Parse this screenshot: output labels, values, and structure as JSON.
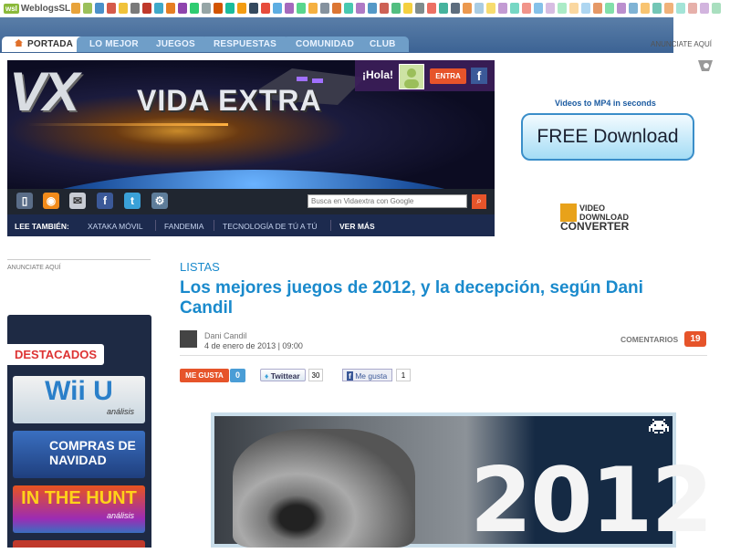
{
  "network": {
    "logo_badge": "wsl",
    "logo_text": "WeblogsSL",
    "site_icon_colors": [
      "#e8a33a",
      "#9bc05a",
      "#4a90c9",
      "#d55a4a",
      "#f0c23a",
      "#7a7a7a",
      "#c0392b",
      "#3fa9c9",
      "#e67e22",
      "#8e44ad",
      "#2ecc71",
      "#95a5a6",
      "#d35400",
      "#1abc9c",
      "#f39c12",
      "#34495e",
      "#e74c3c",
      "#5dade2",
      "#a569bd",
      "#58d68d",
      "#f5b041",
      "#85929e",
      "#dc7633",
      "#48c9b0",
      "#af7ac5",
      "#5499c7",
      "#cd6155",
      "#52be80",
      "#f4d03f",
      "#7f8c8d",
      "#ec7063",
      "#45b39d",
      "#5d6d7e",
      "#eb984e",
      "#a9cce3",
      "#f7dc6f",
      "#c39bd3",
      "#76d7c4",
      "#f1948a",
      "#85c1e9",
      "#d7bde2",
      "#abebc6",
      "#fad7a0",
      "#aed6f1",
      "#e59866",
      "#82e0aa",
      "#bb8fce",
      "#7fb3d5",
      "#f8c471",
      "#73c6b6",
      "#f0b27a",
      "#a3e4d7",
      "#e6b0aa",
      "#d2b4de",
      "#a9dfbf"
    ]
  },
  "nav": {
    "tabs": [
      {
        "label": "PORTADA",
        "active": true
      },
      {
        "label": "LO MEJOR",
        "active": false
      },
      {
        "label": "JUEGOS",
        "active": false
      },
      {
        "label": "RESPUESTAS",
        "active": false
      },
      {
        "label": "COMUNIDAD",
        "active": false
      },
      {
        "label": "CLUB",
        "active": false
      }
    ],
    "anunciate": "ANUNCIATE AQUÍ"
  },
  "banner": {
    "logo_vx": "VX",
    "logo_name": "VIDA EXTRA",
    "hola": "¡Hola!",
    "entra": "ENTRA",
    "facebook": "f",
    "search_placeholder": "Busca en Vidaextra con Google",
    "search_icon": "search-icon",
    "social_icons": [
      "mobile-icon",
      "rss-icon",
      "mail-icon",
      "facebook-icon",
      "twitter-icon",
      "settings-icon"
    ]
  },
  "lee": {
    "label": "LEE TAMBIÉN:",
    "links": [
      "XATAKA MÓVIL",
      "FANDEMIA",
      "TECNOLOGÍA DE TÚ A TÚ"
    ],
    "more": "VER MÁS"
  },
  "ad": {
    "link": "Videos to MP4 in seconds",
    "button": "FREE Download",
    "logo_line1": "VIDEO DOWNLOAD",
    "logo_line2": "CONVERTER"
  },
  "sidebar": {
    "anunciate": "ANUNCIATE AQUÍ",
    "destacados": "DESTACADOS",
    "items": [
      {
        "title": "Wii U",
        "sub": "análisis",
        "bg": "#3a8fd0"
      },
      {
        "title": "COMPRAS DE NAVIDAD",
        "sub": "",
        "bg": "#e8ecf0"
      },
      {
        "title": "IN THE HUNT",
        "sub": "análisis",
        "bg": "#f0a020"
      }
    ]
  },
  "article": {
    "section": "LISTAS",
    "title": "Los mejores juegos de 2012, y la decepción, según Dani Candil",
    "author": "Dani Candil",
    "date": "4 de enero de 2013 | 09:00",
    "comments_label": "COMENTARIOS",
    "comments_count": "19",
    "like_label": "ME GUSTA",
    "like_count": "0",
    "tweet_label": "Twittear",
    "tweet_count": "30",
    "fb_label": "Me gusta",
    "fb_count": "1",
    "hero_year": "2012"
  }
}
